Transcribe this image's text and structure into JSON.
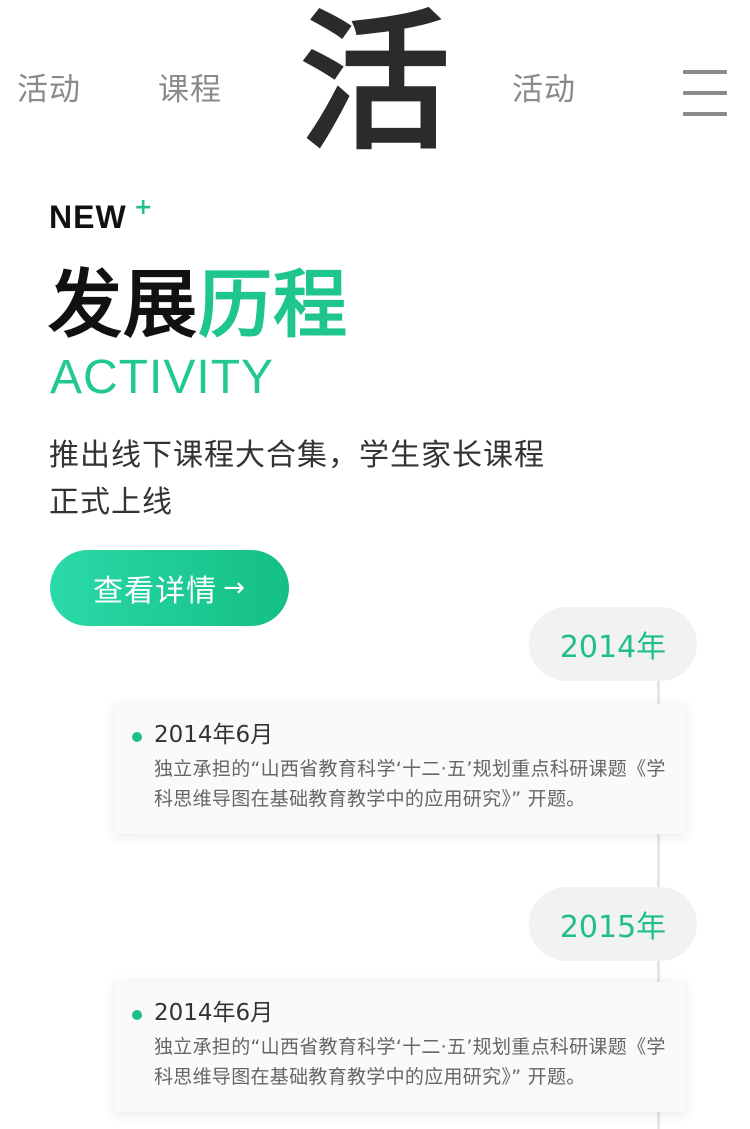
{
  "nav": {
    "left_items": [
      "活动",
      "课程"
    ],
    "logo_char": "活",
    "right_items": [
      "活动"
    ],
    "menu_icon": "hamburger-menu-icon"
  },
  "hero": {
    "badge": "NEW",
    "badge_plus": "+",
    "title_dark": "发展",
    "title_green": "历程",
    "subtitle": "ACTIVITY",
    "description": "推出线下课程大合集，学生家长课程正式上线",
    "cta_label": "查看详情",
    "cta_arrow": "→"
  },
  "timeline": [
    {
      "year": "2014年",
      "events": [
        {
          "date": "2014年6月",
          "text": "独立承担的“山西省教育科学‘十二·五’规划重点科研课题《学科思维导图在基础教育教学中的应用研究》” 开题。"
        }
      ]
    },
    {
      "year": "2015年",
      "events": [
        {
          "date": "2014年6月",
          "text": "独立承担的“山西省教育科学‘十二·五’规划重点科研课题《学科思维导图在基础教育教学中的应用研究》” 开题。"
        }
      ]
    }
  ],
  "colors": {
    "accent": "#1ec58f",
    "text_dark": "#111111",
    "nav_gray": "#8a8a8a"
  }
}
